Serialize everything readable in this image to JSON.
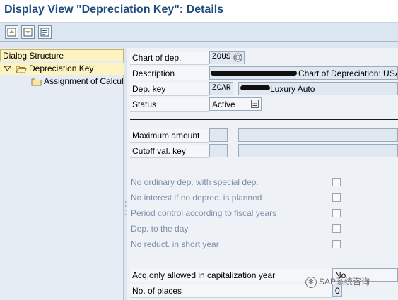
{
  "window": {
    "title": "Display View \"Depreciation Key\": Details"
  },
  "toolbar": {
    "buttons": [
      {
        "name": "previous-entry-button",
        "icon": "page-up-icon"
      },
      {
        "name": "next-entry-button",
        "icon": "page-down-icon"
      },
      {
        "name": "other-entry-button",
        "icon": "select-entry-icon"
      }
    ]
  },
  "dialog_structure": {
    "header": "Dialog Structure",
    "items": [
      {
        "label": "Depreciation Key",
        "expanded": true,
        "selected": true
      },
      {
        "label": "Assignment of Calcul",
        "expanded": false,
        "selected": false
      }
    ]
  },
  "form": {
    "chart_of_dep_label": "Chart of dep.",
    "chart_of_dep_value": "ZOUS",
    "description_label": "Description",
    "description_value": "Chart of Depreciation: USA",
    "dep_key_label": "Dep. key",
    "dep_key_value": "ZCAR",
    "dep_key_desc": "Luxury Auto",
    "status_label": "Status",
    "status_value": "Active",
    "max_amount_label": "Maximum amount",
    "cutoff_label": "Cutoff val. key"
  },
  "options": [
    {
      "label": "No ordinary dep. with special dep.",
      "checked": false
    },
    {
      "label": "No interest if no deprec. is planned",
      "checked": false
    },
    {
      "label": "Period control according to fiscal years",
      "checked": false
    },
    {
      "label": "Dep. to the day",
      "checked": false
    },
    {
      "label": "No reduct. in short year",
      "checked": false
    }
  ],
  "extra": {
    "acq_label": "Acq.only allowed in capitalization year",
    "acq_value": "No",
    "places_label": "No. of places",
    "places_value": "0"
  },
  "watermark": {
    "text": "SAP系统咨询"
  }
}
